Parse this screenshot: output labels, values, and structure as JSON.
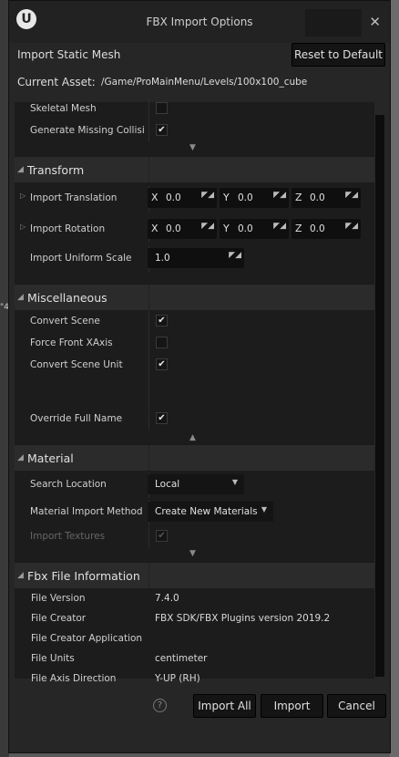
{
  "window": {
    "title": "FBX Import Options",
    "logo": "U",
    "close_glyph": "✕"
  },
  "header": {
    "import_type": "Import Static Mesh",
    "reset_button": "Reset to Default",
    "current_asset_label": "Current Asset:",
    "current_asset_path": "/Game/ProMainMenu/Levels/100x100_cube"
  },
  "background": {
    "marker": "\"4"
  },
  "mesh": {
    "skeletal_mesh": {
      "label": "Skeletal Mesh",
      "checked": false
    },
    "generate_collision": {
      "label": "Generate Missing Collisi",
      "checked": true
    }
  },
  "transform": {
    "title": "Transform",
    "translation": {
      "label": "Import Translation",
      "x": "0.0",
      "y": "0.0",
      "z": "0.0"
    },
    "rotation": {
      "label": "Import Rotation",
      "x": "0.0",
      "y": "0.0",
      "z": "0.0"
    },
    "scale": {
      "label": "Import Uniform Scale",
      "value": "1.0"
    },
    "axes": {
      "x": "X",
      "y": "Y",
      "z": "Z"
    }
  },
  "misc": {
    "title": "Miscellaneous",
    "convert_scene": {
      "label": "Convert Scene",
      "checked": true
    },
    "force_front_xaxis": {
      "label": "Force Front XAxis",
      "checked": false
    },
    "convert_scene_unit": {
      "label": "Convert Scene Unit",
      "checked": true
    },
    "override_full_name": {
      "label": "Override Full Name",
      "checked": true
    }
  },
  "material": {
    "title": "Material",
    "search_location": {
      "label": "Search Location",
      "value": "Local"
    },
    "import_method": {
      "label": "Material Import Method",
      "value": "Create New Materials"
    },
    "import_textures": {
      "label": "Import Textures",
      "checked": true,
      "enabled": false
    }
  },
  "fbx_info": {
    "title": "Fbx File Information",
    "rows": [
      {
        "label": "File Version",
        "value": "7.4.0"
      },
      {
        "label": "File Creator",
        "value": "FBX SDK/FBX Plugins version 2019.2"
      },
      {
        "label": "File Creator Application",
        "value": ""
      },
      {
        "label": "File Units",
        "value": "centimeter"
      },
      {
        "label": "File Axis Direction",
        "value": "Y-UP (RH)"
      }
    ]
  },
  "footer": {
    "help": "?",
    "import_all": "Import All",
    "import": "Import",
    "cancel": "Cancel"
  },
  "glyphs": {
    "check": "✔",
    "expand_down": "▼",
    "collapse_up": "▲",
    "section_open": "◢",
    "row_collapsed": "▷",
    "combo_caret": "▼",
    "spin_grip": "◤◢"
  }
}
